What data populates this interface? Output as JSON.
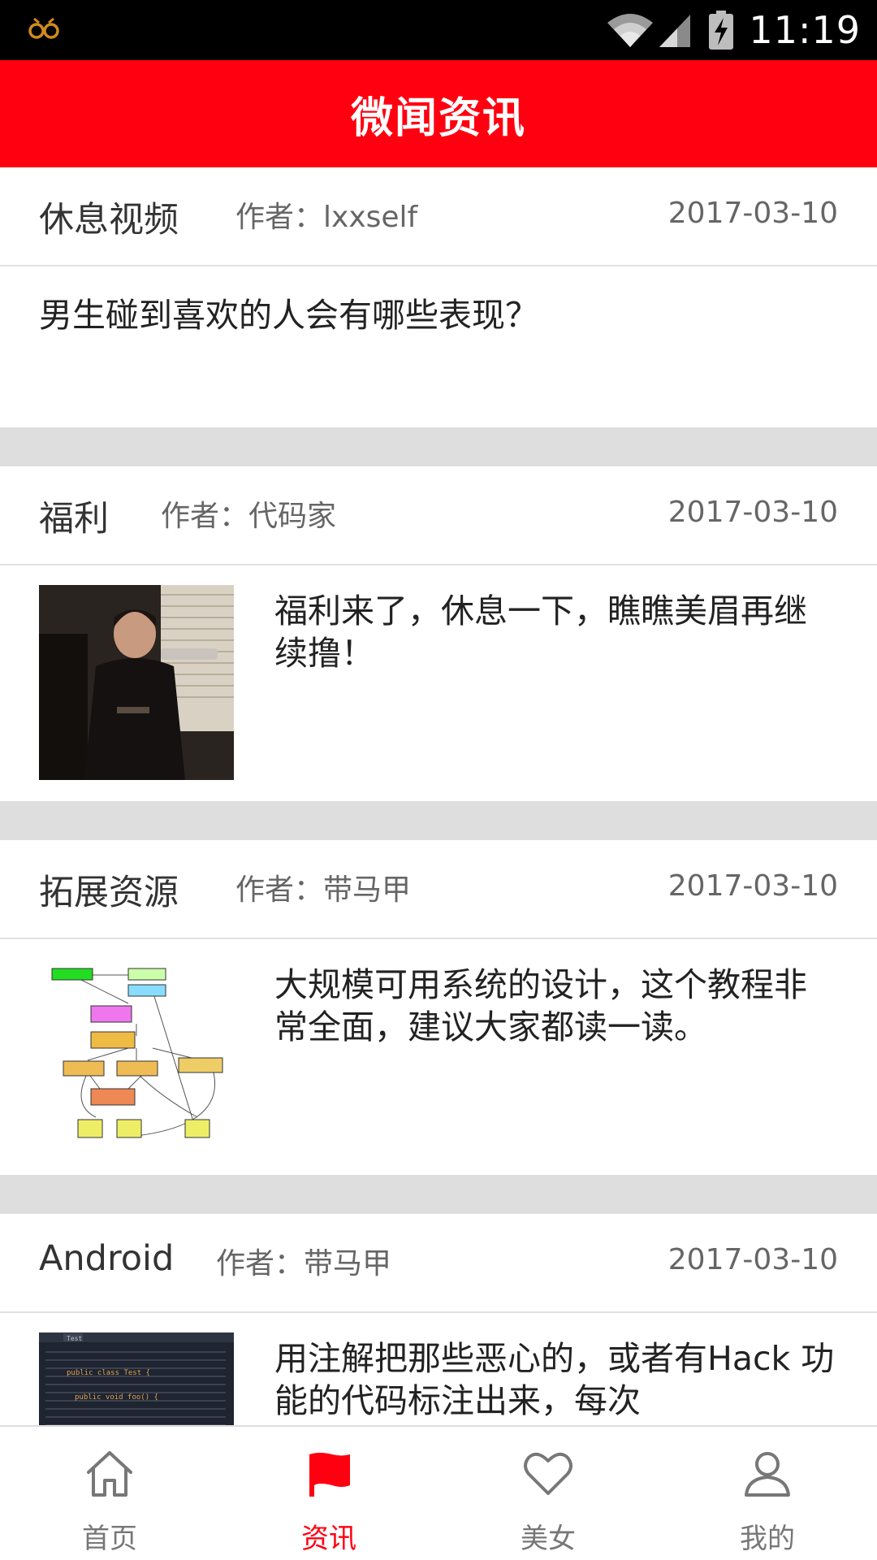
{
  "status_bar": {
    "time": "11:19",
    "app_icon": "infinity-app-icon",
    "icons": [
      "wifi-icon",
      "signal-icon",
      "battery-charging-icon"
    ]
  },
  "header": {
    "title": "微闻资讯"
  },
  "feed": {
    "author_prefix": "作者：",
    "items": [
      {
        "category": "休息视频",
        "author": "lxxself",
        "date": "2017-03-10",
        "text": "男生碰到喜欢的人会有哪些表现？",
        "thumbnail": null
      },
      {
        "category": "福利",
        "author": "代码家",
        "date": "2017-03-10",
        "text": "福利来了，休息一下，瞧瞧美眉再继续撸！",
        "thumbnail": "photo-thumbnail"
      },
      {
        "category": "拓展资源",
        "author": "带马甲",
        "date": "2017-03-10",
        "text": "大规模可用系统的设计，这个教程非常全面，建议大家都读一读。",
        "thumbnail": "diagram-thumbnail"
      },
      {
        "category": "Android",
        "author": "带马甲",
        "date": "2017-03-10",
        "text": "用注解把那些恶心的，或者有Hack 功能的代码标注出来，每次",
        "thumbnail": "code-thumbnail",
        "thumbnail_code": {
          "tab": "Test",
          "line1": "public class Test {",
          "line2": "public void foo() {"
        }
      }
    ]
  },
  "bottom_nav": {
    "items": [
      {
        "label": "首页",
        "icon": "home-icon",
        "active": false
      },
      {
        "label": "资讯",
        "icon": "news-flag-icon",
        "active": true
      },
      {
        "label": "美女",
        "icon": "heart-icon",
        "active": false
      },
      {
        "label": "我的",
        "icon": "user-icon",
        "active": false
      }
    ]
  },
  "colors": {
    "accent": "#ff0010",
    "separator": "#dedede",
    "text_primary": "#222222",
    "text_secondary": "#666666"
  }
}
